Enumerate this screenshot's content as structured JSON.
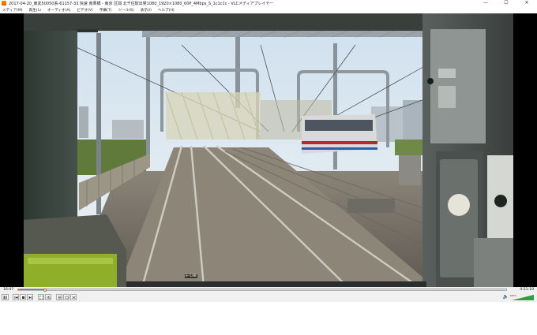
{
  "window": {
    "title": "2017-04-20_東武50050系-61157-33 快速 南栗橋 - 東京 区間 北千住駅出発1080_1920×1080_60P_4Mbps_S_1c1c1c - VLCメディアプレイヤー",
    "controls": {
      "minimize": "—",
      "maximize": "☐",
      "close": "✕"
    }
  },
  "menu": {
    "items": [
      "メディア(M)",
      "再生(L)",
      "オーディオ(A)",
      "ビデオ(V)",
      "字幕(T)",
      "ツール(S)",
      "表示(I)",
      "ヘルプ(H)"
    ]
  },
  "video": {
    "watermark": "e-LAB"
  },
  "playback": {
    "elapsed": "16:47",
    "total": "4:51:10",
    "progress_fraction": 0.055
  },
  "volume": {
    "label": "100%",
    "level_fraction": 1.0
  },
  "colors": {
    "accent": "#3b82d6",
    "volume_green": "#2ea043"
  }
}
